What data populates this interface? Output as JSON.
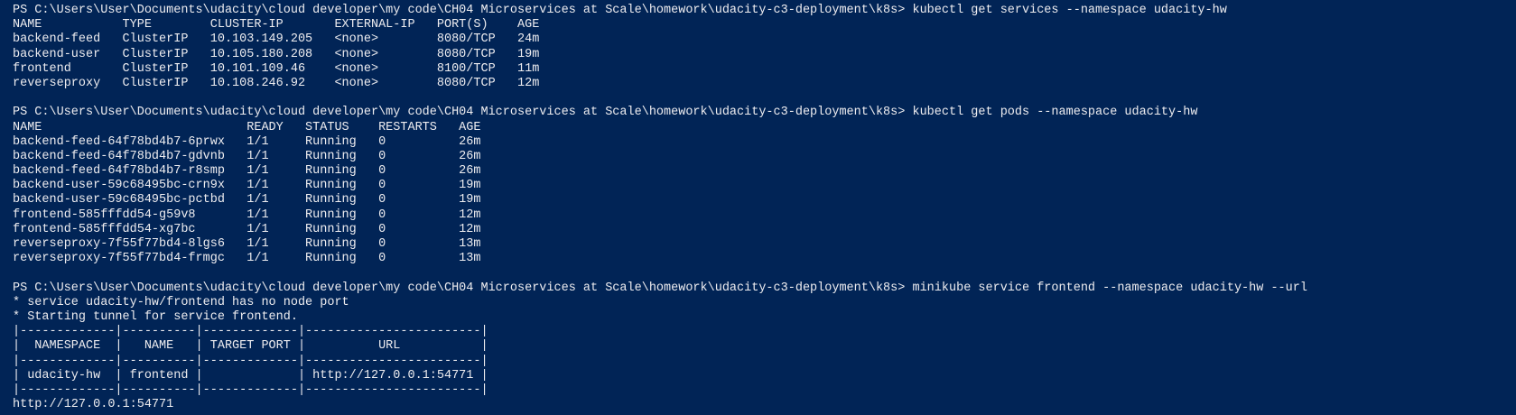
{
  "window": {
    "background_color": "#012456",
    "text_color": "#eeedf0"
  },
  "session": {
    "prompt": "PS C:\\Users\\User\\Documents\\udacity\\cloud developer\\my code\\CH04 Microservices at Scale\\homework\\udacity-c3-deployment\\k8s>",
    "blocks": [
      {
        "command": "kubectl get services --namespace udacity-hw",
        "output": [
          "NAME           TYPE        CLUSTER-IP       EXTERNAL-IP   PORT(S)    AGE",
          "backend-feed   ClusterIP   10.103.149.205   <none>        8080/TCP   24m",
          "backend-user   ClusterIP   10.105.180.208   <none>        8080/TCP   19m",
          "frontend       ClusterIP   10.101.109.46    <none>        8100/TCP   11m",
          "reverseproxy   ClusterIP   10.108.246.92    <none>        8080/TCP   12m"
        ]
      },
      {
        "command": "kubectl get pods --namespace udacity-hw",
        "output": [
          "NAME                            READY   STATUS    RESTARTS   AGE",
          "backend-feed-64f78bd4b7-6prwx   1/1     Running   0          26m",
          "backend-feed-64f78bd4b7-gdvnb   1/1     Running   0          26m",
          "backend-feed-64f78bd4b7-r8smp   1/1     Running   0          26m",
          "backend-user-59c68495bc-crn9x   1/1     Running   0          19m",
          "backend-user-59c68495bc-pctbd   1/1     Running   0          19m",
          "frontend-585fffdd54-g59v8       1/1     Running   0          12m",
          "frontend-585fffdd54-xg7bc       1/1     Running   0          12m",
          "reverseproxy-7f55f77bd4-8lgs6   1/1     Running   0          13m",
          "reverseproxy-7f55f77bd4-frmgc   1/1     Running   0          13m"
        ]
      },
      {
        "command": "minikube service frontend --namespace udacity-hw --url",
        "output": [
          "* service udacity-hw/frontend has no node port",
          "* Starting tunnel for service frontend.",
          "|-------------|----------|-------------|------------------------|",
          "|  NAMESPACE  |   NAME   | TARGET PORT |          URL           |",
          "|-------------|----------|-------------|------------------------|",
          "| udacity-hw  | frontend |             | http://127.0.0.1:54771 |",
          "|-------------|----------|-------------|------------------------|",
          "http://127.0.0.1:54771"
        ]
      }
    ]
  }
}
